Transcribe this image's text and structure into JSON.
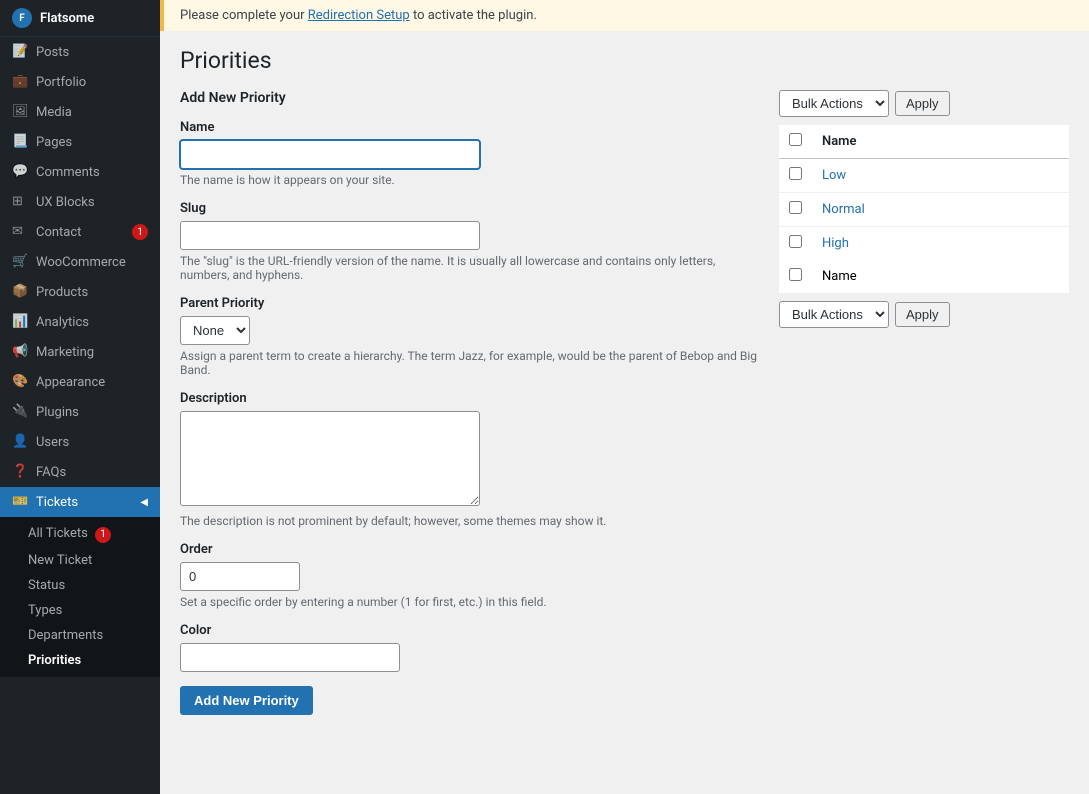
{
  "sidebar": {
    "brand": "Flatsome",
    "items": [
      {
        "id": "posts",
        "label": "Posts",
        "icon": "📄"
      },
      {
        "id": "portfolio",
        "label": "Portfolio",
        "icon": "💼"
      },
      {
        "id": "media",
        "label": "Media",
        "icon": "🖼"
      },
      {
        "id": "pages",
        "label": "Pages",
        "icon": "📃"
      },
      {
        "id": "comments",
        "label": "Comments",
        "icon": "💬"
      },
      {
        "id": "ux-blocks",
        "label": "UX Blocks",
        "icon": "⊞"
      },
      {
        "id": "contact",
        "label": "Contact",
        "icon": "✉",
        "badge": "1"
      },
      {
        "id": "woocommerce",
        "label": "WooCommerce",
        "icon": "🛒"
      },
      {
        "id": "products",
        "label": "Products",
        "icon": "📦"
      },
      {
        "id": "analytics",
        "label": "Analytics",
        "icon": "📊"
      },
      {
        "id": "marketing",
        "label": "Marketing",
        "icon": "📢"
      },
      {
        "id": "appearance",
        "label": "Appearance",
        "icon": "🎨"
      },
      {
        "id": "plugins",
        "label": "Plugins",
        "icon": "🔌"
      },
      {
        "id": "users",
        "label": "Users",
        "icon": "👤"
      },
      {
        "id": "faqs",
        "label": "FAQs",
        "icon": "❓"
      },
      {
        "id": "tickets",
        "label": "Tickets",
        "icon": "🎫",
        "active": true
      }
    ],
    "submenu": {
      "title": "Tickets",
      "items": [
        {
          "id": "all-tickets",
          "label": "All Tickets",
          "badge": "1"
        },
        {
          "id": "new-ticket",
          "label": "New Ticket"
        },
        {
          "id": "status",
          "label": "Status"
        },
        {
          "id": "types",
          "label": "Types"
        },
        {
          "id": "departments",
          "label": "Departments"
        },
        {
          "id": "priorities",
          "label": "Priorities",
          "active": true
        }
      ]
    }
  },
  "notice": {
    "text": "Please complete your ",
    "link_text": "Redirection Setup",
    "suffix": " to activate the plugin."
  },
  "page": {
    "title": "Priorities"
  },
  "form": {
    "section_title": "Add New Priority",
    "name_label": "Name",
    "name_placeholder": "",
    "name_hint": "The name is how it appears on your site.",
    "slug_label": "Slug",
    "slug_placeholder": "",
    "slug_hint": "The \"slug\" is the URL-friendly version of the name. It is usually all lowercase and contains only letters, numbers, and hyphens.",
    "parent_label": "Parent Priority",
    "parent_options": [
      "None"
    ],
    "parent_hint": "Assign a parent term to create a hierarchy. The term Jazz, for example, would be the parent of Bebop and Big Band.",
    "desc_label": "Description",
    "desc_placeholder": "",
    "desc_hint": "The description is not prominent by default; however, some themes may show it.",
    "order_label": "Order",
    "order_value": "0",
    "order_hint": "Set a specific order by entering a number (1 for first, etc.) in this field.",
    "color_label": "Color",
    "color_placeholder": "",
    "submit_label": "Add New Priority"
  },
  "bulk_top": {
    "select_label": "Bulk Actions",
    "apply_label": "Apply"
  },
  "bulk_bottom": {
    "select_label": "Bulk Actions",
    "apply_label": "Apply"
  },
  "priorities_table": {
    "col_name": "Name",
    "rows": [
      {
        "id": "low",
        "name": "Low"
      },
      {
        "id": "normal",
        "name": "Normal"
      },
      {
        "id": "high",
        "name": "High"
      }
    ],
    "footer_name": "Name"
  }
}
